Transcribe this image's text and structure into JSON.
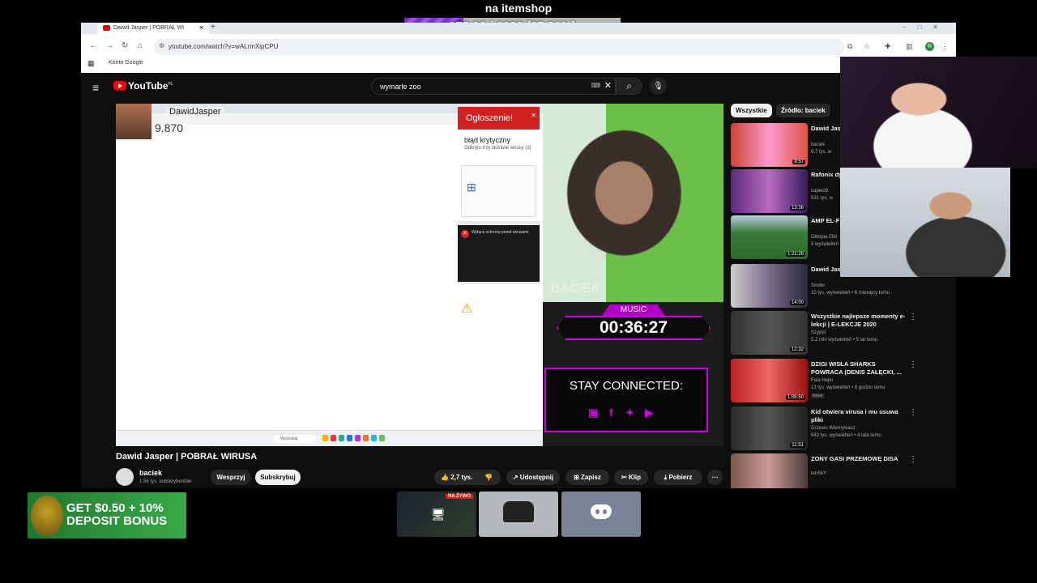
{
  "overlay": {
    "top_label": "na itemshop",
    "goal_text": "278.06 / 1020 (27.26%)",
    "goal_fraction": 0.2726
  },
  "browser": {
    "tab_title": "Dawid Jasper | POBRAŁ WI",
    "url": "youtube.com/watch?v=wALrmXipCPU",
    "bookmark": "Konto Google",
    "profile_initial": "R"
  },
  "youtube": {
    "logo": "YouTube",
    "logo_region": "PL",
    "search_value": "wymarle zoo",
    "video_title": "Dawid Jasper | POBRAŁ WIRUSA",
    "channel_name": "baciek",
    "channel_subs": "1,56 tys. subskrybentów",
    "support_label": "Wesprzyj",
    "subscribe_label": "Subskrybuj",
    "likes": "2,7 tys.",
    "share_label": "Udostępnij",
    "save_label": "Zapisz",
    "clip_label": "Klip",
    "download_label": "Pobierz"
  },
  "player": {
    "streamer_name": "DawidJasper",
    "streamer_value": "9.870",
    "popup_title": "Ogłoszenie!",
    "popup_heading": "błąd krytyczny",
    "popup_sub": "Odkryto trzy złośliwe wirusy (3)",
    "popup2_text": "Wyłącz ochronę przed wirusami",
    "cam_watermark": "BACIEK",
    "music_label": "MUSIC",
    "music_time": "00:36:27",
    "stay_connected": "STAY CONNECTED:",
    "taskbar_search": "Wyszukaj"
  },
  "sidebar": {
    "chips": [
      "Wszystkie",
      "Źródło: baciek"
    ],
    "items": [
      {
        "title": "Dawid Jas",
        "channel": "baciek",
        "meta": "9,7 tys. w",
        "duration": "9:57"
      },
      {
        "title": "Rafonix dy wróżki",
        "channel": "capeio9",
        "meta": "531 tys. w",
        "duration": "13:36"
      },
      {
        "title": "AMP EL-F Olimpia Elb",
        "channel": "Olimpia Elbl",
        "meta": "5 wyświetleń",
        "duration": "1:21:26"
      },
      {
        "title": "Dawid Jas mecz o 5ZŁ w CS2",
        "channel": "Sinder",
        "meta": "10 tys. wyświetleń • 6 miesięcy temu",
        "duration": "14:00"
      },
      {
        "title": "Wszystkie najlepsze momenty e- lekcji | E-LEKCJE 2020",
        "channel": "Szypol",
        "meta": "5,2 mln wyświetleń • 5 lat temu",
        "duration": "12:32"
      },
      {
        "title": "DZIGI WISŁA SHARKS POWRACA (DENIS ZAŁĘCKI, ...",
        "channel": "Fala Hejtu",
        "meta": "13 tys. wyświetleń • 8 godzin temu",
        "duration": "1:08:50",
        "badge": "Nowy"
      },
      {
        "title": "Kid otwiera virusa i mu usuwa pliki",
        "channel": "Grzesiu Wiernywacz",
        "meta": "643 tys. wyświetleń • 4 lata temu",
        "duration": "11:51"
      },
      {
        "title": "ZONY GASI PRZEMOWĘ DISA",
        "channel": "ianSkY",
        "meta": "",
        "duration": ""
      }
    ],
    "badge_new": "Nowy"
  },
  "bottom": {
    "ad_text": "GET $0.50 + 10% DEPOSIT BONUS",
    "live_badge": "NA ŻYWO"
  },
  "colors": {
    "accent_purple": "#d200e8",
    "youtube_red": "#ff0000",
    "popup_red": "#d21f1f"
  }
}
